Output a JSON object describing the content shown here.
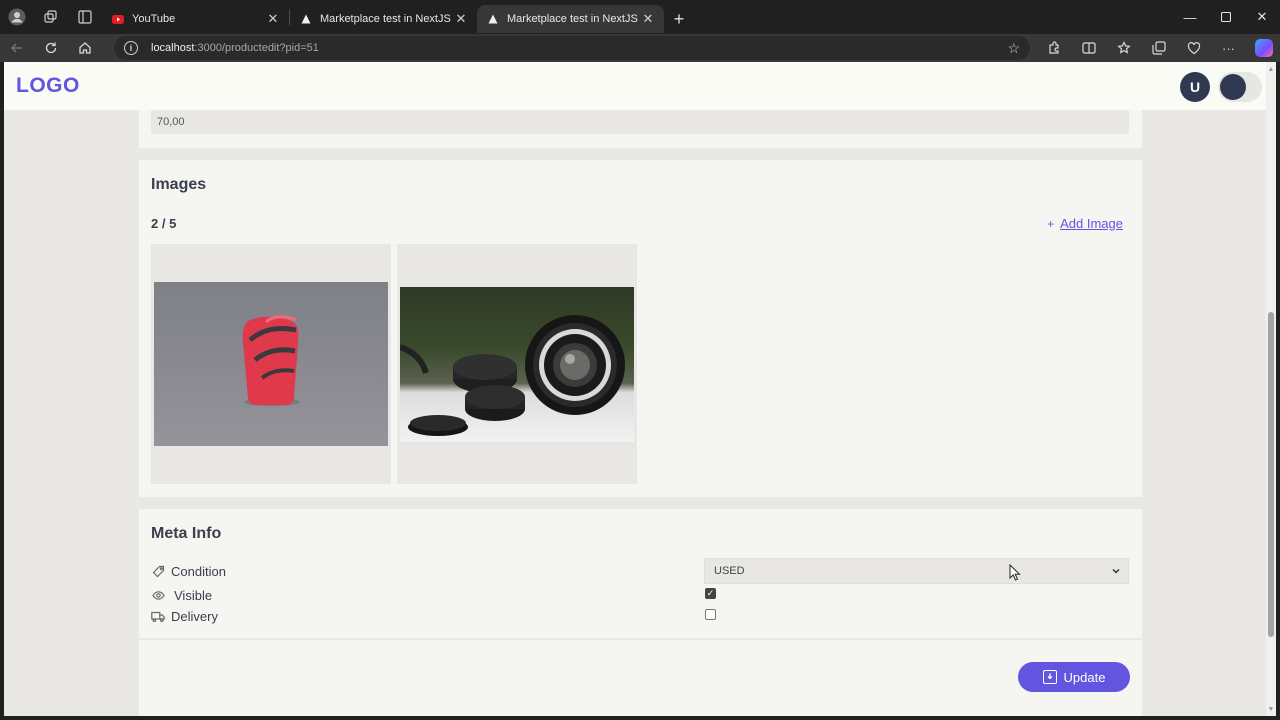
{
  "browser": {
    "tabs": [
      {
        "title": "YouTube",
        "favicon": "youtube-icon",
        "active": false
      },
      {
        "title": "Marketplace test in NextJS",
        "favicon": "nextjs-icon",
        "active": false
      },
      {
        "title": "Marketplace test in NextJS",
        "favicon": "nextjs-icon",
        "active": true
      }
    ],
    "url_host": "localhost",
    "url_path": ":3000/productedit?pid=51"
  },
  "header": {
    "logo": "LOGO",
    "user_initial": "U"
  },
  "price": {
    "value": "70,00"
  },
  "images": {
    "title": "Images",
    "count": "2 / 5",
    "add_label": "Add Image",
    "items": [
      {
        "alt": "red lighter-like object",
        "icon": "product-photo"
      },
      {
        "alt": "camera lens and caps",
        "icon": "product-photo"
      }
    ]
  },
  "meta": {
    "title": "Meta Info",
    "condition_label": "Condition",
    "condition_value": "USED",
    "visible_label": "Visible",
    "visible_checked": true,
    "delivery_label": "Delivery",
    "delivery_checked": false
  },
  "actions": {
    "update_label": "Update"
  },
  "colors": {
    "accent": "#6455e0",
    "avatar": "#2f3a52",
    "page_bg": "#e9e8e5",
    "panel_bg": "#f5f5f2"
  }
}
